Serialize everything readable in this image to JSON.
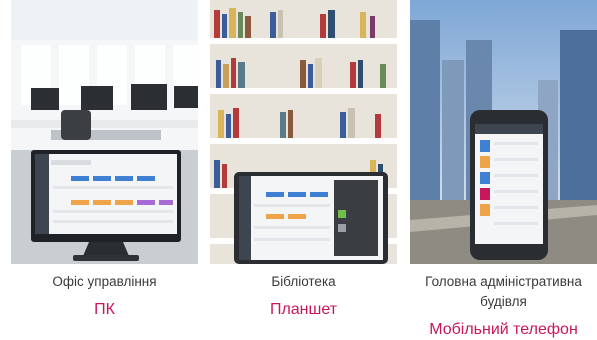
{
  "accent_color": "#c8175d",
  "cards": [
    {
      "place": "Офіс управління",
      "device": "ПК",
      "scene_icon": "office-scene",
      "device_icon": "monitor-icon"
    },
    {
      "place": "Бібліотека",
      "device": "Планшет",
      "scene_icon": "library-scene",
      "device_icon": "tablet-icon"
    },
    {
      "place": "Головна адміністративна будівля",
      "device": "Мобільний телефон",
      "scene_icon": "city-scene",
      "device_icon": "phone-icon"
    }
  ]
}
